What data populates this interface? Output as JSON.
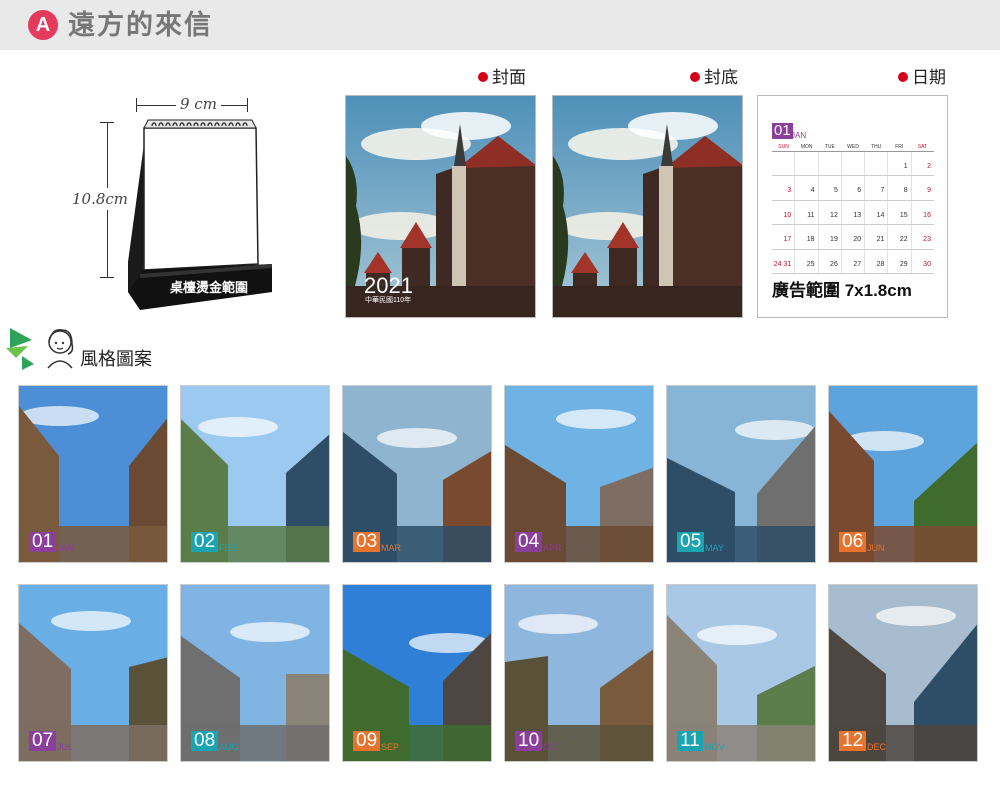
{
  "header": {
    "badge": "A",
    "title": "遠方的來信"
  },
  "calendar_illustration": {
    "width_label": "9 cm",
    "height_label": "10.8cm",
    "base_text": "桌檯燙金範圍"
  },
  "previews": {
    "front": {
      "label": "封面",
      "year": "2021",
      "subtitle": "中華民國110年"
    },
    "back": {
      "label": "封底"
    },
    "date": {
      "label": "日期",
      "month_num": "01",
      "month_name": "JAN",
      "weekdays": [
        "SUN",
        "MON",
        "TUE",
        "WED",
        "THU",
        "FRI",
        "SAT"
      ],
      "weeks": [
        [
          "",
          "",
          "",
          "",
          "",
          "1",
          "2"
        ],
        [
          "3",
          "4",
          "5",
          "6",
          "7",
          "8",
          "9"
        ],
        [
          "10",
          "11",
          "12",
          "13",
          "14",
          "15",
          "16"
        ],
        [
          "17",
          "18",
          "19",
          "20",
          "21",
          "22",
          "23"
        ],
        [
          "24 31",
          "25",
          "26",
          "27",
          "28",
          "29",
          "30"
        ]
      ],
      "ad_text": "廣告範圍 7x1.8cm"
    }
  },
  "styles_section": {
    "title": "風格圖案"
  },
  "months": [
    {
      "num": "01",
      "name": "JAN",
      "color": "#8a3f9a",
      "sky": "#4d8fd6"
    },
    {
      "num": "02",
      "name": "FEB",
      "color": "#1aa3b0",
      "sky": "#9cc9ef"
    },
    {
      "num": "03",
      "name": "MAR",
      "color": "#e8732c",
      "sky": "#8fb4cf"
    },
    {
      "num": "04",
      "name": "APR",
      "color": "#8a3f9a",
      "sky": "#6fb2e4"
    },
    {
      "num": "05",
      "name": "MAY",
      "color": "#1aa3b0",
      "sky": "#87b5d6"
    },
    {
      "num": "06",
      "name": "JUN",
      "color": "#e8732c",
      "sky": "#5ea4dc"
    },
    {
      "num": "07",
      "name": "JUL",
      "color": "#8a3f9a",
      "sky": "#6aaee6"
    },
    {
      "num": "08",
      "name": "AUG",
      "color": "#1aa3b0",
      "sky": "#7fb4e3"
    },
    {
      "num": "09",
      "name": "SEP",
      "color": "#e8732c",
      "sky": "#2f7fd6"
    },
    {
      "num": "10",
      "name": "OCT",
      "color": "#8a3f9a",
      "sky": "#8fb6dc"
    },
    {
      "num": "11",
      "name": "NOV",
      "color": "#1aa3b0",
      "sky": "#a9c8e6"
    },
    {
      "num": "12",
      "name": "DEC",
      "color": "#e8732c",
      "sky": "#a8bcd0"
    }
  ]
}
